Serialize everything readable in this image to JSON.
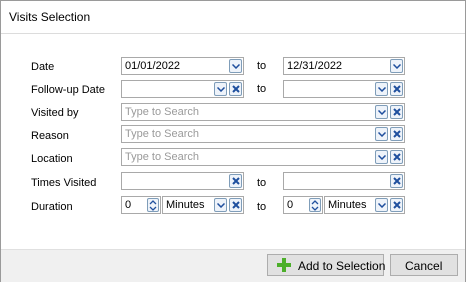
{
  "window": {
    "title": "Visits Selection"
  },
  "form": {
    "date": {
      "label": "Date",
      "from": "01/01/2022",
      "to_label": "to",
      "to": "12/31/2022"
    },
    "followup": {
      "label": "Follow-up Date",
      "from": "",
      "to_label": "to",
      "to": ""
    },
    "visited_by": {
      "label": "Visited by",
      "placeholder": "Type to Search"
    },
    "reason": {
      "label": "Reason",
      "placeholder": "Type to Search"
    },
    "location": {
      "label": "Location",
      "placeholder": "Type to Search"
    },
    "times_visited": {
      "label": "Times Visited",
      "from": "",
      "to_label": "to",
      "to": ""
    },
    "duration": {
      "label": "Duration",
      "from_value": "0",
      "from_unit": "Minutes",
      "to_label": "to",
      "to_value": "0",
      "to_unit": "Minutes"
    }
  },
  "buttons": {
    "add": "Add to Selection",
    "cancel": "Cancel"
  },
  "colors": {
    "accent_green": "#4caf2a",
    "clear_blue": "#1f4f9e"
  }
}
